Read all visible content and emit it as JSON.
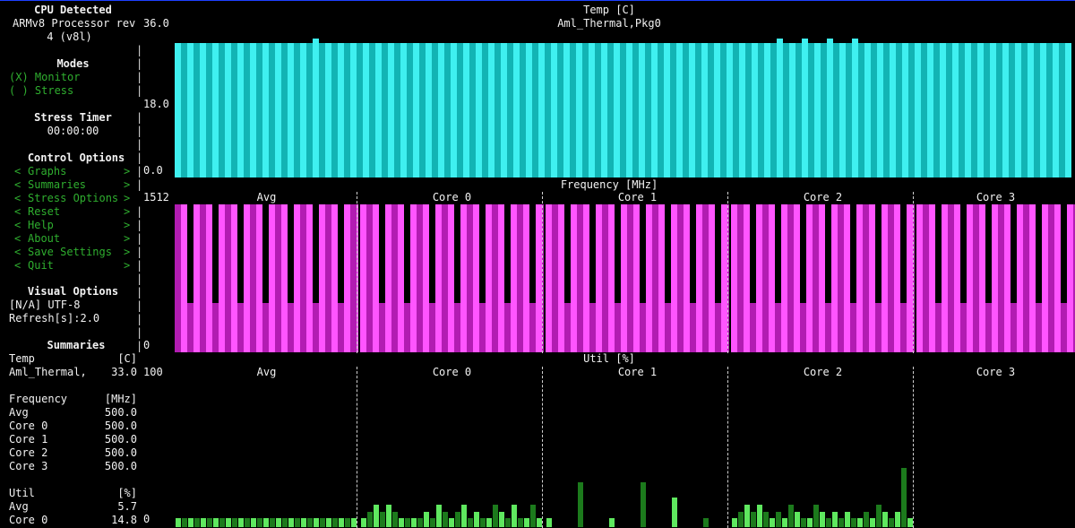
{
  "sidebar": {
    "cpu_title": "CPU Detected",
    "cpu_line1": "ARMv8 Processor rev",
    "cpu_line2": "4 (v8l)",
    "modes_title": "Modes",
    "modes": [
      {
        "label": "(X) Monitor",
        "selected": true
      },
      {
        "label": "( ) Stress",
        "selected": false
      }
    ],
    "stress_timer_title": "Stress Timer",
    "stress_timer_value": "00:00:00",
    "control_title": "Control Options",
    "control_items": [
      {
        "label": "Graphs"
      },
      {
        "label": "Summaries"
      },
      {
        "label": "Stress Options"
      },
      {
        "label": "Reset"
      },
      {
        "label": "Help"
      },
      {
        "label": "About"
      },
      {
        "label": "Save Settings"
      },
      {
        "label": "Quit"
      }
    ],
    "item_left_char": "<",
    "item_right_char": ">",
    "visual_title": "Visual Options",
    "visual_line1": "[N/A] UTF-8",
    "visual_line2": "Refresh[s]:2.0",
    "summaries_title": "Summaries",
    "summaries": {
      "temp": {
        "header": "Temp",
        "unit": "[C]",
        "rows": [
          {
            "label": "Aml_Thermal,",
            "value": "33.0"
          }
        ]
      },
      "frequency": {
        "header": "Frequency",
        "unit": "[MHz]",
        "rows": [
          {
            "label": "Avg",
            "value": "500.0"
          },
          {
            "label": "Core 0",
            "value": "500.0"
          },
          {
            "label": "Core 1",
            "value": "500.0"
          },
          {
            "label": "Core 2",
            "value": "500.0"
          },
          {
            "label": "Core 3",
            "value": "500.0"
          }
        ]
      },
      "util": {
        "header": "Util",
        "unit": "[%]",
        "rows": [
          {
            "label": "Avg",
            "value": "5.7"
          },
          {
            "label": "Core 0",
            "value": "14.8"
          }
        ]
      }
    }
  },
  "temp_graph": {
    "title": "Temp [C]",
    "subtitle": "Aml_Thermal,Pkg0",
    "y_ticks": [
      "36.0",
      "18.0",
      "0.0"
    ],
    "color_light": "#3ff0f0",
    "color_dark": "#12b4b4",
    "ymax": 36,
    "base_value": 33.0,
    "spike_value": 34.0,
    "spike_indexes": [
      11,
      48,
      50,
      52,
      54
    ]
  },
  "freq_graph": {
    "title": "Frequency [MHz]",
    "y_ticks": [
      "1512",
      "0"
    ],
    "color_light": "#ff55ff",
    "color_dark": "#b21cb2",
    "panels": [
      "Avg",
      "Core 0",
      "Core 1",
      "Core 2",
      "Core 3"
    ],
    "ymax": 1512,
    "high_value": 1512,
    "low_value": 500
  },
  "util_graph": {
    "title": "Util [%]",
    "y_ticks": [
      "100",
      "0"
    ],
    "color_light": "#5fe85f",
    "color_dark": "#1c7a1c",
    "panels": [
      "Avg",
      "Core 0",
      "Core 1",
      "Core 2",
      "Core 3"
    ],
    "ymax": 100
  },
  "chart_data": [
    {
      "type": "bar",
      "title": "Temp [C]",
      "series": [
        {
          "name": "Aml_Thermal,Pkg0",
          "note_values": "mostly 33.0 with occasional 34.0"
        }
      ],
      "ylim": [
        0,
        36.0
      ]
    },
    {
      "type": "bar",
      "title": "Frequency [MHz]",
      "categories": [
        "Avg",
        "Core 0",
        "Core 1",
        "Core 2",
        "Core 3"
      ],
      "values_recent": [
        500.0,
        500.0,
        500.0,
        500.0,
        500.0
      ],
      "ylim": [
        0,
        1512
      ]
    },
    {
      "type": "bar",
      "title": "Util [%]",
      "categories": [
        "Avg",
        "Core 0",
        "Core 1",
        "Core 2",
        "Core 3"
      ],
      "values_recent": [
        5.7,
        14.8
      ],
      "ylim": [
        0,
        100
      ]
    }
  ]
}
